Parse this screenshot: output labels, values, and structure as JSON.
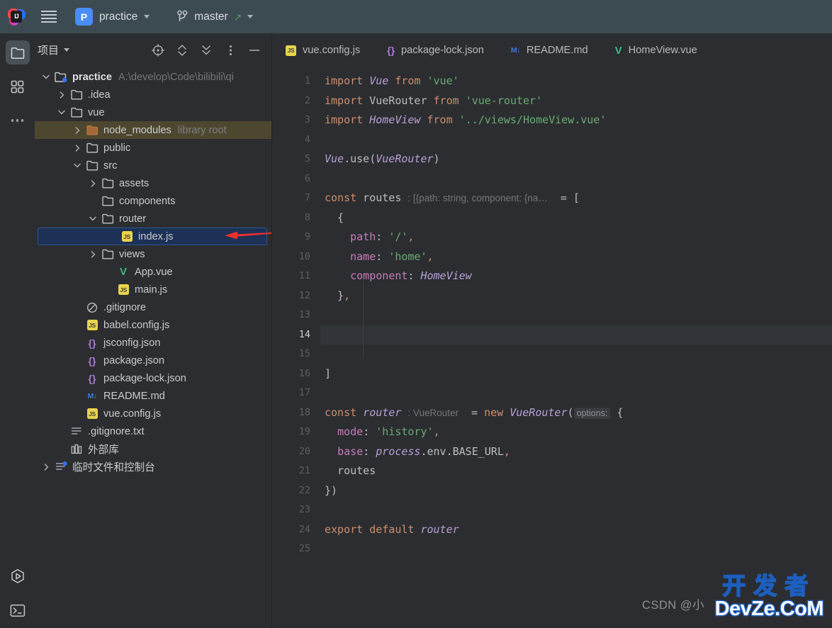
{
  "titlebar": {
    "logo_name": "intellij-idea-logo",
    "menu_label": "hamburger-menu",
    "project_badge": "P",
    "project_name": "practice",
    "branch_name": "master",
    "branch_icon": "git-branch-icon",
    "push_icon": "↗"
  },
  "stripe": {
    "top_items": [
      {
        "name": "project-tool-window",
        "icon": "folder-icon",
        "active": true
      },
      {
        "name": "structure-tool-window",
        "icon": "grid-icon",
        "active": false
      },
      {
        "name": "more-tool-windows",
        "icon": "more-dots-icon",
        "active": false
      }
    ],
    "bottom_items": [
      {
        "name": "run-tool-window",
        "icon": "run-hexagon-icon"
      },
      {
        "name": "terminal-tool-window",
        "icon": "terminal-icon"
      }
    ]
  },
  "project_panel": {
    "title": "项目",
    "toolbar": [
      {
        "name": "select-opened-file-icon",
        "glyph": "target-icon"
      },
      {
        "name": "expand-collapse-icon",
        "glyph": "chevrons-updown-icon"
      },
      {
        "name": "collapse-all-icon",
        "glyph": "collapse-all-icon"
      },
      {
        "name": "options-icon",
        "glyph": "vertical-dots-icon"
      },
      {
        "name": "hide-icon",
        "glyph": "minimize-icon"
      }
    ],
    "tree": [
      {
        "indent": 0,
        "twisty": "v",
        "icon": "module-folder",
        "label": "practice",
        "bold": true,
        "sub": "A:\\develop\\Code\\bilibili\\qi"
      },
      {
        "indent": 1,
        "twisty": ">",
        "icon": "folder",
        "label": ".idea"
      },
      {
        "indent": 1,
        "twisty": "v",
        "icon": "folder",
        "label": "vue"
      },
      {
        "indent": 2,
        "twisty": ">",
        "icon": "folder-excluded",
        "label": "node_modules",
        "sub": "library root",
        "highlight": "library"
      },
      {
        "indent": 2,
        "twisty": ">",
        "icon": "folder",
        "label": "public"
      },
      {
        "indent": 2,
        "twisty": "v",
        "icon": "folder",
        "label": "src"
      },
      {
        "indent": 3,
        "twisty": ">",
        "icon": "folder",
        "label": "assets"
      },
      {
        "indent": 3,
        "twisty": "",
        "icon": "folder",
        "label": "components"
      },
      {
        "indent": 3,
        "twisty": "v",
        "icon": "folder",
        "label": "router"
      },
      {
        "indent": 4,
        "twisty": "",
        "icon": "js",
        "label": "index.js",
        "selected": true
      },
      {
        "indent": 3,
        "twisty": ">",
        "icon": "folder",
        "label": "views"
      },
      {
        "indent": 4,
        "twisty": "",
        "icon": "vue",
        "label": "App.vue"
      },
      {
        "indent": 4,
        "twisty": "",
        "icon": "js",
        "label": "main.js"
      },
      {
        "indent": 2,
        "twisty": "",
        "icon": "gitignore",
        "label": ".gitignore"
      },
      {
        "indent": 2,
        "twisty": "",
        "icon": "js",
        "label": "babel.config.js"
      },
      {
        "indent": 2,
        "twisty": "",
        "icon": "json",
        "label": "jsconfig.json"
      },
      {
        "indent": 2,
        "twisty": "",
        "icon": "json",
        "label": "package.json"
      },
      {
        "indent": 2,
        "twisty": "",
        "icon": "json",
        "label": "package-lock.json"
      },
      {
        "indent": 2,
        "twisty": "",
        "icon": "md",
        "label": "README.md"
      },
      {
        "indent": 2,
        "twisty": "",
        "icon": "js",
        "label": "vue.config.js"
      },
      {
        "indent": 1,
        "twisty": "",
        "icon": "txt",
        "label": ".gitignore.txt"
      },
      {
        "indent": 1,
        "twisty": "",
        "icon": "library",
        "label": "外部库"
      },
      {
        "indent": 0,
        "twisty": ">",
        "icon": "scratches",
        "label": "临时文件和控制台"
      }
    ],
    "annotation": {
      "name": "red-arrow-annotation",
      "points_to": "index.js",
      "color": "#e8302f"
    }
  },
  "editor": {
    "tabs": [
      {
        "icon": "js",
        "label": "vue.config.js",
        "active": false
      },
      {
        "icon": "json",
        "label": "package-lock.json",
        "active": false
      },
      {
        "icon": "md",
        "label": "README.md",
        "active": false
      },
      {
        "icon": "vue",
        "label": "HomeView.vue",
        "active": false
      }
    ],
    "current_line": 14,
    "total_lines": 25,
    "line_numbers": [
      "1",
      "2",
      "3",
      "4",
      "5",
      "6",
      "7",
      "8",
      "9",
      "10",
      "11",
      "12",
      "13",
      "14",
      "15",
      "16",
      "17",
      "18",
      "19",
      "20",
      "21",
      "22",
      "23",
      "24",
      "25"
    ],
    "code_lines": [
      {
        "n": 1,
        "tokens": [
          {
            "t": "kw",
            "v": "import"
          },
          {
            "t": "plain",
            "v": " "
          },
          {
            "t": "cls",
            "v": "Vue"
          },
          {
            "t": "plain",
            "v": " "
          },
          {
            "t": "kw",
            "v": "from"
          },
          {
            "t": "plain",
            "v": " "
          },
          {
            "t": "str",
            "v": "'vue'"
          }
        ]
      },
      {
        "n": 2,
        "tokens": [
          {
            "t": "kw",
            "v": "import"
          },
          {
            "t": "plain",
            "v": " VueRouter "
          },
          {
            "t": "kw",
            "v": "from"
          },
          {
            "t": "plain",
            "v": " "
          },
          {
            "t": "str",
            "v": "'vue-router'"
          }
        ]
      },
      {
        "n": 3,
        "tokens": [
          {
            "t": "kw",
            "v": "import"
          },
          {
            "t": "plain",
            "v": " "
          },
          {
            "t": "cls",
            "v": "HomeView"
          },
          {
            "t": "plain",
            "v": " "
          },
          {
            "t": "kw",
            "v": "from"
          },
          {
            "t": "plain",
            "v": " "
          },
          {
            "t": "str",
            "v": "'../views/HomeView.vue'"
          }
        ]
      },
      {
        "n": 4,
        "tokens": []
      },
      {
        "n": 5,
        "tokens": [
          {
            "t": "cls",
            "v": "Vue"
          },
          {
            "t": "plain",
            "v": "."
          },
          {
            "t": "fn",
            "v": "use"
          },
          {
            "t": "plain",
            "v": "("
          },
          {
            "t": "cls",
            "v": "VueRouter"
          },
          {
            "t": "plain",
            "v": ")"
          }
        ]
      },
      {
        "n": 6,
        "tokens": []
      },
      {
        "n": 7,
        "tokens": [
          {
            "t": "kw",
            "v": "const"
          },
          {
            "t": "plain",
            "v": " routes "
          },
          {
            "t": "hint",
            "v": ": [{path: string, component: {na…"
          },
          {
            "t": "plain",
            "v": "  = ["
          }
        ]
      },
      {
        "n": 8,
        "tokens": [
          {
            "t": "plain",
            "v": "  {"
          }
        ]
      },
      {
        "n": 9,
        "tokens": [
          {
            "t": "plain",
            "v": "    "
          },
          {
            "t": "prop",
            "v": "path"
          },
          {
            "t": "plain",
            "v": ": "
          },
          {
            "t": "str",
            "v": "'/'"
          },
          {
            "t": "comma",
            "v": ","
          }
        ]
      },
      {
        "n": 10,
        "tokens": [
          {
            "t": "plain",
            "v": "    "
          },
          {
            "t": "prop",
            "v": "name"
          },
          {
            "t": "plain",
            "v": ": "
          },
          {
            "t": "str",
            "v": "'home'"
          },
          {
            "t": "comma",
            "v": ","
          }
        ]
      },
      {
        "n": 11,
        "tokens": [
          {
            "t": "plain",
            "v": "    "
          },
          {
            "t": "prop",
            "v": "component"
          },
          {
            "t": "plain",
            "v": ": "
          },
          {
            "t": "cls",
            "v": "HomeView"
          }
        ]
      },
      {
        "n": 12,
        "tokens": [
          {
            "t": "plain",
            "v": "  }"
          },
          {
            "t": "comma",
            "v": ","
          }
        ]
      },
      {
        "n": 13,
        "tokens": []
      },
      {
        "n": 14,
        "tokens": [],
        "current": true
      },
      {
        "n": 15,
        "tokens": []
      },
      {
        "n": 16,
        "tokens": [
          {
            "t": "plain",
            "v": "]"
          }
        ]
      },
      {
        "n": 17,
        "tokens": []
      },
      {
        "n": 18,
        "tokens": [
          {
            "t": "kw",
            "v": "const"
          },
          {
            "t": "plain",
            "v": " "
          },
          {
            "t": "cls",
            "v": "router"
          },
          {
            "t": "plain",
            "v": " "
          },
          {
            "t": "hint",
            "v": ": VueRouter"
          },
          {
            "t": "plain",
            "v": "  = "
          },
          {
            "t": "kw",
            "v": "new"
          },
          {
            "t": "plain",
            "v": " "
          },
          {
            "t": "cls",
            "v": "VueRouter"
          },
          {
            "t": "plain",
            "v": "("
          },
          {
            "t": "hintbox",
            "v": "options:"
          },
          {
            "t": "plain",
            "v": " {"
          }
        ]
      },
      {
        "n": 19,
        "tokens": [
          {
            "t": "plain",
            "v": "  "
          },
          {
            "t": "prop",
            "v": "mode"
          },
          {
            "t": "plain",
            "v": ": "
          },
          {
            "t": "str",
            "v": "'history'"
          },
          {
            "t": "comma",
            "v": ","
          }
        ]
      },
      {
        "n": 20,
        "tokens": [
          {
            "t": "plain",
            "v": "  "
          },
          {
            "t": "prop",
            "v": "base"
          },
          {
            "t": "plain",
            "v": ": "
          },
          {
            "t": "cls",
            "v": "process"
          },
          {
            "t": "plain",
            "v": ".env.BASE_URL"
          },
          {
            "t": "comma",
            "v": ","
          }
        ]
      },
      {
        "n": 21,
        "tokens": [
          {
            "t": "plain",
            "v": "  routes"
          }
        ]
      },
      {
        "n": 22,
        "tokens": [
          {
            "t": "plain",
            "v": "})"
          }
        ]
      },
      {
        "n": 23,
        "tokens": []
      },
      {
        "n": 24,
        "tokens": [
          {
            "t": "kw",
            "v": "export"
          },
          {
            "t": "plain",
            "v": " "
          },
          {
            "t": "kw",
            "v": "default"
          },
          {
            "t": "plain",
            "v": " "
          },
          {
            "t": "cls",
            "v": "router"
          }
        ]
      },
      {
        "n": 25,
        "tokens": []
      }
    ]
  },
  "watermark": {
    "csdn": "CSDN @小",
    "cn": "开发者",
    "en": "DevZe.CoM"
  },
  "colors": {
    "titlebar_bg": "#3c4b51",
    "panel_bg": "#2b2d30",
    "selection_bg": "#1d3055",
    "selection_border": "#2f5891",
    "library_row_bg": "#4e472f",
    "accent_blue": "#4a8df8",
    "vue_green": "#41b883",
    "js_yellow": "#e8d44d",
    "json_purple": "#b07cd8",
    "md_blue": "#3a7bd8",
    "annotation_red": "#e8302f"
  }
}
